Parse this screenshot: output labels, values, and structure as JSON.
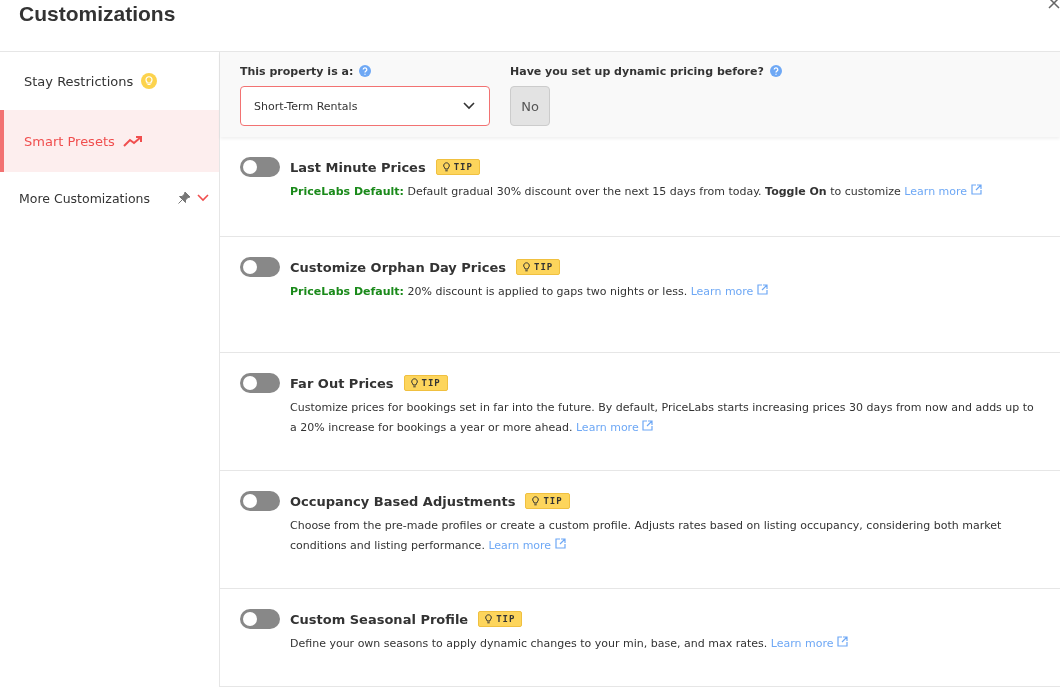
{
  "title": "Customizations",
  "sidebar": {
    "items": [
      {
        "label": "Stay Restrictions",
        "selected": false
      },
      {
        "label": "Smart Presets",
        "selected": true
      },
      {
        "label": "More Customizations",
        "selected": false
      }
    ]
  },
  "property": {
    "label": "This property is a:",
    "value": "Short-Term Rentals"
  },
  "dynamic_pricing": {
    "label": "Have you set up dynamic pricing before?",
    "answer": "No"
  },
  "settings": [
    {
      "name": "Last Minute Prices",
      "on": false,
      "tip": "TIP",
      "default_label": "PriceLabs Default:",
      "description": "Default gradual 30% discount over the next 15 days from today. **Toggle On** to customize",
      "link": "Learn more"
    },
    {
      "name": "Customize Orphan Day Prices",
      "on": false,
      "tip": "TIP",
      "default_label": "PriceLabs Default:",
      "description": "20% discount is applied to gaps two nights or less.",
      "link": "Learn more"
    },
    {
      "name": "Far Out Prices",
      "on": false,
      "tip": "TIP",
      "description": "Customize prices for bookings set in far into the future. By default, PriceLabs starts increasing prices 30 days from now and adds up to a 20% increase for bookings a year or more ahead.",
      "link": "Learn more"
    },
    {
      "name": "Occupancy Based Adjustments",
      "on": false,
      "tip": "TIP",
      "description": "Choose from the pre-made profiles or create a custom profile. Adjusts rates based on listing occupancy, considering both market conditions and listing performance.",
      "link": "Learn more"
    },
    {
      "name": "Custom Seasonal Profile",
      "on": false,
      "tip": "TIP",
      "description": "Define your own seasons to apply dynamic changes to your min, base, and max rates.",
      "link": "Learn more"
    }
  ]
}
